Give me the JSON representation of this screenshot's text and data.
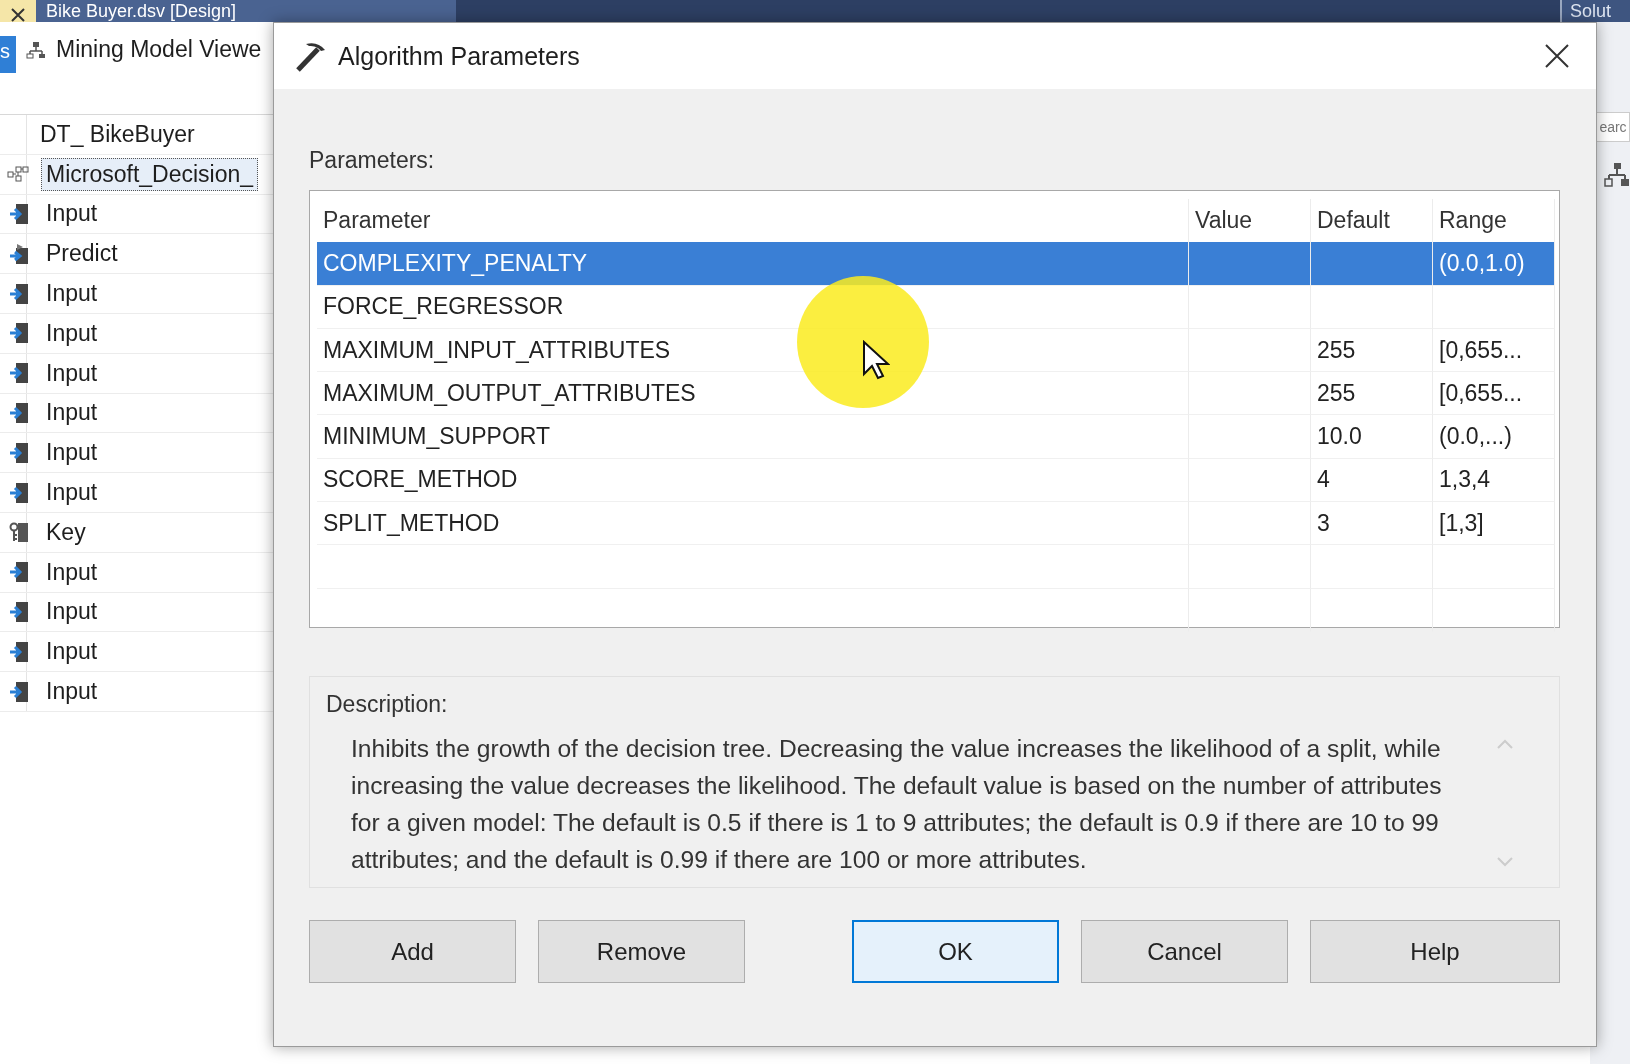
{
  "top_bar": {
    "document_tab": "Bike Buyer.dsv [Design]",
    "right_tab": "Solut"
  },
  "left_panel": {
    "side_tab": "s",
    "viewer_tab": "Mining Model Viewe",
    "tree": {
      "root": "DT_ BikeBuyer",
      "model": {
        "label": "Microsoft_Decision_",
        "selected": true
      },
      "columns": [
        {
          "kind": "input",
          "label": "Input"
        },
        {
          "kind": "predict",
          "label": "Predict"
        },
        {
          "kind": "input",
          "label": "Input"
        },
        {
          "kind": "input",
          "label": "Input"
        },
        {
          "kind": "input",
          "label": "Input"
        },
        {
          "kind": "input",
          "label": "Input"
        },
        {
          "kind": "input",
          "label": "Input"
        },
        {
          "kind": "input",
          "label": "Input"
        },
        {
          "kind": "key",
          "label": "Key"
        },
        {
          "kind": "input",
          "label": "Input"
        },
        {
          "kind": "input",
          "label": "Input"
        },
        {
          "kind": "input",
          "label": "Input"
        },
        {
          "kind": "input",
          "label": "Input"
        }
      ]
    }
  },
  "right_strip": {
    "search": {
      "placeholder": "earc"
    }
  },
  "dialog": {
    "title": "Algorithm Parameters",
    "parameters_label": "Parameters:",
    "table": {
      "columns": [
        "Parameter",
        "Value",
        "Default",
        "Range"
      ],
      "rows": [
        {
          "cells": [
            "COMPLEXITY_PENALTY",
            "",
            "",
            "(0.0,1.0)"
          ],
          "selected": true
        },
        {
          "cells": [
            "FORCE_REGRESSOR",
            "",
            "",
            ""
          ],
          "selected": false
        },
        {
          "cells": [
            "MAXIMUM_INPUT_ATTRIBUTES",
            "",
            "255",
            "[0,655..."
          ],
          "selected": false
        },
        {
          "cells": [
            "MAXIMUM_OUTPUT_ATTRIBUTES",
            "",
            "255",
            "[0,655..."
          ],
          "selected": false
        },
        {
          "cells": [
            "MINIMUM_SUPPORT",
            "",
            "10.0",
            "(0.0,...)"
          ],
          "selected": false
        },
        {
          "cells": [
            "SCORE_METHOD",
            "",
            "4",
            "1,3,4"
          ],
          "selected": false
        },
        {
          "cells": [
            "SPLIT_METHOD",
            "",
            "3",
            "[1,3]"
          ],
          "selected": false
        }
      ]
    },
    "description_label": "Description:",
    "description": "Inhibits the growth of the decision tree. Decreasing the value increases the likelihood of a split, while increasing the value decreases the likelihood. The default value is based on the number of attributes for a given model: The default is 0.5 if there is 1 to 9 attributes; the default is 0.9 if there are 10 to 99 attributes; and the default is 0.99 if there are 100 or more attributes.",
    "buttons": [
      {
        "label": "Add",
        "focused": false
      },
      {
        "label": "Remove",
        "focused": false
      },
      {
        "label": "OK",
        "focused": true
      },
      {
        "label": "Cancel",
        "focused": false
      },
      {
        "label": "Help",
        "focused": false
      }
    ]
  }
}
